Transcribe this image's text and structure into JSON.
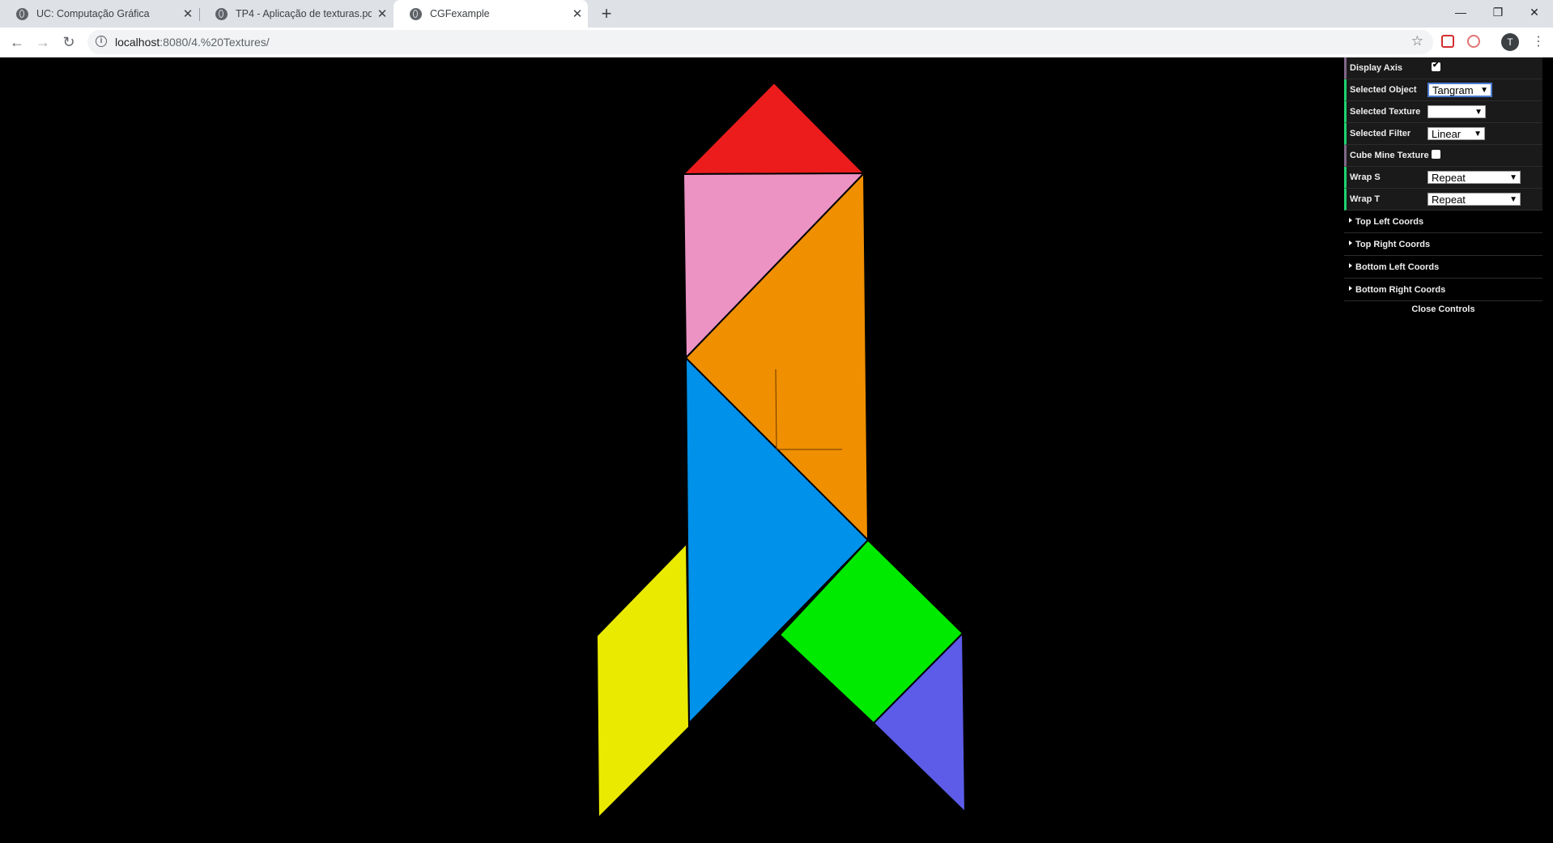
{
  "tabs": [
    {
      "title": "UC: Computação Gráfica",
      "close": "✕"
    },
    {
      "title": "TP4 - Aplicação de texturas.pdf",
      "close": "✕"
    },
    {
      "title": "CGFexample",
      "close": "✕"
    }
  ],
  "newtab_label": "+",
  "window_controls": {
    "minimize": "—",
    "maximize": "❐",
    "close": "✕"
  },
  "nav": {
    "back": "←",
    "forward": "→",
    "reload": "↻"
  },
  "address": {
    "host": "localhost",
    "path": ":8080/4.%20Textures/",
    "info_icon": "i",
    "bookmark_star": "☆"
  },
  "profile": {
    "initial": "T"
  },
  "menu_icon": "⋮",
  "colors": {
    "red": "#ec1c1c",
    "pink": "#ec93c4",
    "orange": "#f08f00",
    "blue": "#0091ea",
    "green": "#00ea00",
    "yellow": "#eaea00",
    "purple": "#5c5ce8"
  },
  "gui": {
    "display_axis": {
      "label": "Display Axis",
      "checked": true
    },
    "selected_object": {
      "label": "Selected Object",
      "value": "Tangram"
    },
    "selected_texture": {
      "label": "Selected Texture",
      "value": ""
    },
    "selected_filter": {
      "label": "Selected Filter",
      "value": "Linear"
    },
    "cube_mine_texture": {
      "label": "Cube Mine Texture",
      "checked": false
    },
    "wrap_s": {
      "label": "Wrap S",
      "value": "Repeat"
    },
    "wrap_t": {
      "label": "Wrap T",
      "value": "Repeat"
    },
    "folders": [
      "Top Left Coords",
      "Top Right Coords",
      "Bottom Left Coords",
      "Bottom Right Coords"
    ],
    "close_controls": "Close Controls"
  }
}
